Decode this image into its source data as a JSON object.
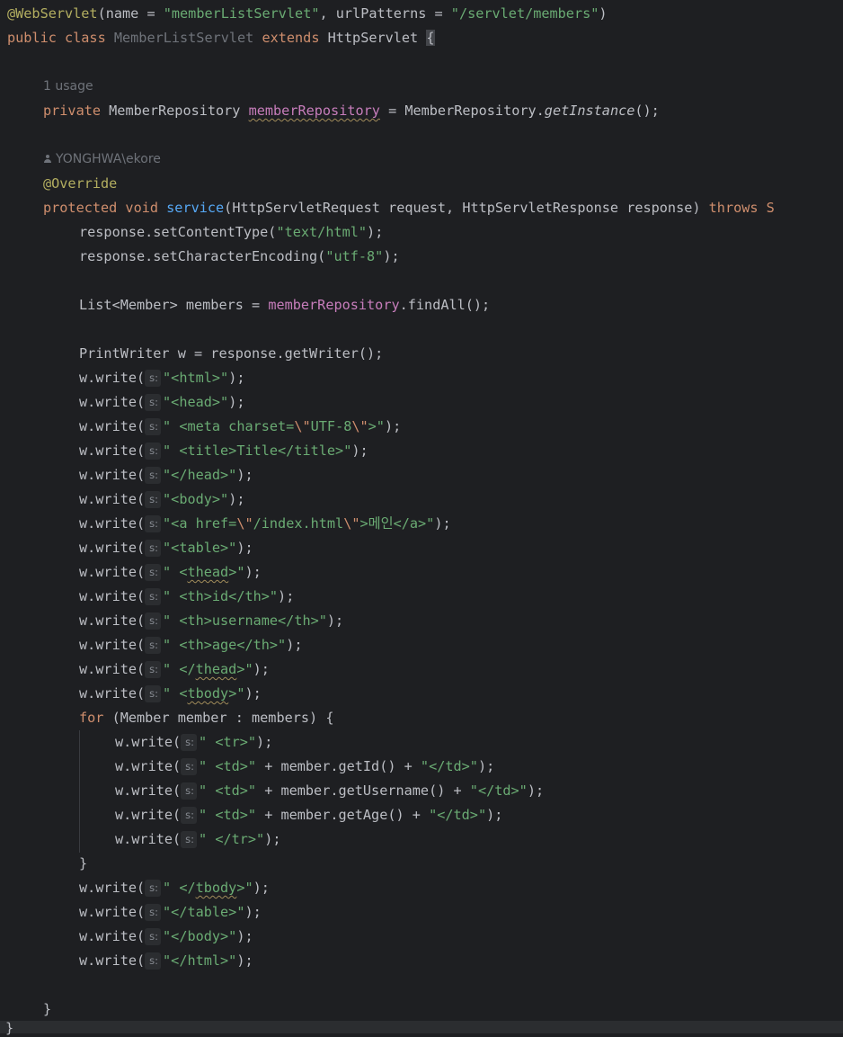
{
  "editor": {
    "colors": {
      "background": "#1e1f22",
      "keyword": "#cf8e6d",
      "string": "#6aab73",
      "annotation": "#b3ae60",
      "field": "#c77dbb",
      "function": "#56a8f5",
      "text": "#bcbec4",
      "muted": "#6f737a"
    },
    "param_hint_label": "s:",
    "usage_hint": "1 usage",
    "author_hint": "YONGHWA\\ekore",
    "author_icon": "person-icon",
    "lines": {
      "l1": {
        "a": "@WebServlet",
        "b": "(name = ",
        "c": "\"memberListServlet\"",
        "d": ", urlPatterns = ",
        "e": "\"/servlet/members\"",
        "f": ")"
      },
      "l2": {
        "a": "public class ",
        "b": "MemberListServlet ",
        "c": "extends ",
        "d": "HttpServlet ",
        "e": "{"
      },
      "l3": {
        "a": "private ",
        "b": "MemberRepository ",
        "c": "memberRepository",
        "d": " = MemberRepository.",
        "e": "getInstance",
        "f": "();"
      },
      "l4": {
        "a": "@Override"
      },
      "l5": {
        "a": "protected void ",
        "b": "service",
        "c": "(HttpServletRequest request, HttpServletResponse response) ",
        "d": "throws S"
      },
      "l6": {
        "a": "response.setContentType(",
        "b": "\"text/html\"",
        "c": ");"
      },
      "l7": {
        "a": "response.setCharacterEncoding(",
        "b": "\"utf-8\"",
        "c": ");"
      },
      "l8": {
        "a": "List<Member> members = ",
        "b": "memberRepository",
        "c": ".findAll();"
      },
      "l9": {
        "a": "PrintWriter w = response.getWriter();"
      },
      "w1": {
        "a": "w.write(",
        "b": "\"<html>\"",
        "c": ");"
      },
      "w2": {
        "a": "w.write(",
        "b": "\"<head>\"",
        "c": ");"
      },
      "w3": {
        "a": "w.write(",
        "b": "\" <meta charset=",
        "c": "\\\"",
        "d": "UTF-8",
        "e": "\\\"",
        "f": ">\"",
        "g": ");"
      },
      "w4": {
        "a": "w.write(",
        "b": "\" <title>Title</title>\"",
        "c": ");"
      },
      "w5": {
        "a": "w.write(",
        "b": "\"</head>\"",
        "c": ");"
      },
      "w6": {
        "a": "w.write(",
        "b": "\"<body>\"",
        "c": ");"
      },
      "w7": {
        "a": "w.write(",
        "b": "\"<a href=",
        "c": "\\\"",
        "d": "/index.html",
        "e": "\\\"",
        "f": ">메인</a>\"",
        "g": ");"
      },
      "w8": {
        "a": "w.write(",
        "b": "\"<table>\"",
        "c": ");"
      },
      "w9": {
        "a": "w.write(",
        "b": "\" <",
        "c": "thead",
        "d": ">\"",
        "e": ");"
      },
      "w10": {
        "a": "w.write(",
        "b": "\" <th>id</th>\"",
        "c": ");"
      },
      "w11": {
        "a": "w.write(",
        "b": "\" <th>username</th>\"",
        "c": ");"
      },
      "w12": {
        "a": "w.write(",
        "b": "\" <th>age</th>\"",
        "c": ");"
      },
      "w13": {
        "a": "w.write(",
        "b": "\" </",
        "c": "thead",
        "d": ">\"",
        "e": ");"
      },
      "w14": {
        "a": "w.write(",
        "b": "\" <",
        "c": "tbody",
        "d": ">\"",
        "e": ");"
      },
      "for": {
        "a": "for ",
        "b": "(Member member : members) {"
      },
      "f1": {
        "a": "w.write(",
        "b": "\" <tr>\"",
        "c": ");"
      },
      "f2": {
        "a": "w.write(",
        "b": "\" <td>\"",
        "c": " + member.getId() + ",
        "d": "\"</td>\"",
        "e": ");"
      },
      "f3": {
        "a": "w.write(",
        "b": "\" <td>\"",
        "c": " + member.getUsername() + ",
        "d": "\"</td>\"",
        "e": ");"
      },
      "f4": {
        "a": "w.write(",
        "b": "\" <td>\"",
        "c": " + member.getAge() + ",
        "d": "\"</td>\"",
        "e": ");"
      },
      "f5": {
        "a": "w.write(",
        "b": "\" </tr>\"",
        "c": ");"
      },
      "endfor": {
        "a": "}"
      },
      "w15": {
        "a": "w.write(",
        "b": "\" </",
        "c": "tbody",
        "d": ">\"",
        "e": ");"
      },
      "w16": {
        "a": "w.write(",
        "b": "\"</table>\"",
        "c": ");"
      },
      "w17": {
        "a": "w.write(",
        "b": "\"</body>\"",
        "c": ");"
      },
      "w18": {
        "a": "w.write(",
        "b": "\"</html>\"",
        "c": ");"
      },
      "endmethod": {
        "a": "}"
      },
      "endclass": {
        "a": "}"
      }
    }
  }
}
